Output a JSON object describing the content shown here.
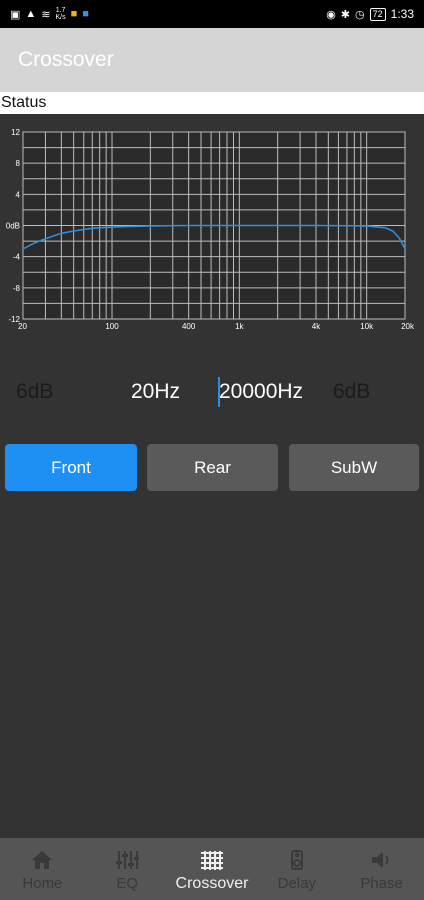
{
  "status_bar": {
    "left_icons": [
      "nfc-icon",
      "signal-icon",
      "wifi-icon"
    ],
    "net_speed_value": "1.7",
    "net_speed_unit": "K/s",
    "right_icons": [
      "eye-icon",
      "bluetooth-icon",
      "alarm-icon"
    ],
    "battery": "72",
    "time": "1:33"
  },
  "appbar": {
    "title": "Crossover"
  },
  "status_label": "Status",
  "chart_data": {
    "type": "line",
    "x_scale": "log",
    "xlim": [
      20,
      20000
    ],
    "ylim": [
      -12,
      12
    ],
    "y_ticks": [
      "12",
      "8",
      "4",
      "0dB",
      "-4",
      "-8",
      "-12"
    ],
    "x_ticks": [
      "20",
      "100",
      "400",
      "1k",
      "4k",
      "10k",
      "20k"
    ],
    "grid": true,
    "line_color": "#2f8fd8",
    "series": [
      {
        "x": [
          20,
          25,
          30,
          40,
          50,
          70,
          100,
          200,
          400,
          1000,
          4000,
          10000,
          14000,
          16000,
          18000,
          20000
        ],
        "values": [
          -3.0,
          -2.2,
          -1.7,
          -1.0,
          -0.7,
          -0.35,
          -0.2,
          -0.05,
          0,
          0,
          0,
          -0.05,
          -0.3,
          -0.7,
          -1.6,
          -3.0
        ]
      }
    ]
  },
  "crossover": {
    "left_slope": "6dB",
    "low_freq": "20Hz",
    "high_freq": "20000Hz",
    "right_slope": "6dB"
  },
  "channels": [
    {
      "label": "Front",
      "active": true
    },
    {
      "label": "Rear",
      "active": false
    },
    {
      "label": "SubW",
      "active": false
    }
  ],
  "nav": [
    {
      "label": "Home",
      "icon": "home-icon",
      "active": false
    },
    {
      "label": "EQ",
      "icon": "eq-sliders-icon",
      "active": false
    },
    {
      "label": "Crossover",
      "icon": "crossover-icon",
      "active": true
    },
    {
      "label": "Delay",
      "icon": "delay-icon",
      "active": false
    },
    {
      "label": "Phase",
      "icon": "speaker-icon",
      "active": false
    }
  ]
}
